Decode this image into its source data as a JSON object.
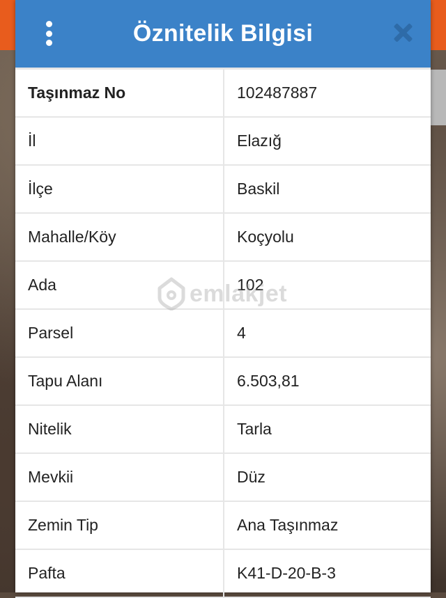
{
  "dialog": {
    "title": "Öznitelik Bilgisi"
  },
  "rows": [
    {
      "label": "Taşınmaz No",
      "value": "102487887"
    },
    {
      "label": "İl",
      "value": "Elazığ"
    },
    {
      "label": "İlçe",
      "value": "Baskil"
    },
    {
      "label": "Mahalle/Köy",
      "value": "Koçyolu"
    },
    {
      "label": "Ada",
      "value": "102"
    },
    {
      "label": "Parsel",
      "value": "4"
    },
    {
      "label": "Tapu Alanı",
      "value": "6.503,81"
    },
    {
      "label": "Nitelik",
      "value": "Tarla"
    },
    {
      "label": "Mevkii",
      "value": "Düz"
    },
    {
      "label": "Zemin Tip",
      "value": "Ana Taşınmaz"
    },
    {
      "label": "Pafta",
      "value": "K41-D-20-B-3"
    }
  ],
  "watermark": {
    "text": "emlakjet",
    "icon": "house-pin-icon"
  },
  "colors": {
    "header": "#3b82c8",
    "close": "#2e6ba8",
    "accent_orange": "#e85c1d"
  },
  "icons": {
    "menu": "kebab-menu-icon",
    "close": "close-icon"
  }
}
